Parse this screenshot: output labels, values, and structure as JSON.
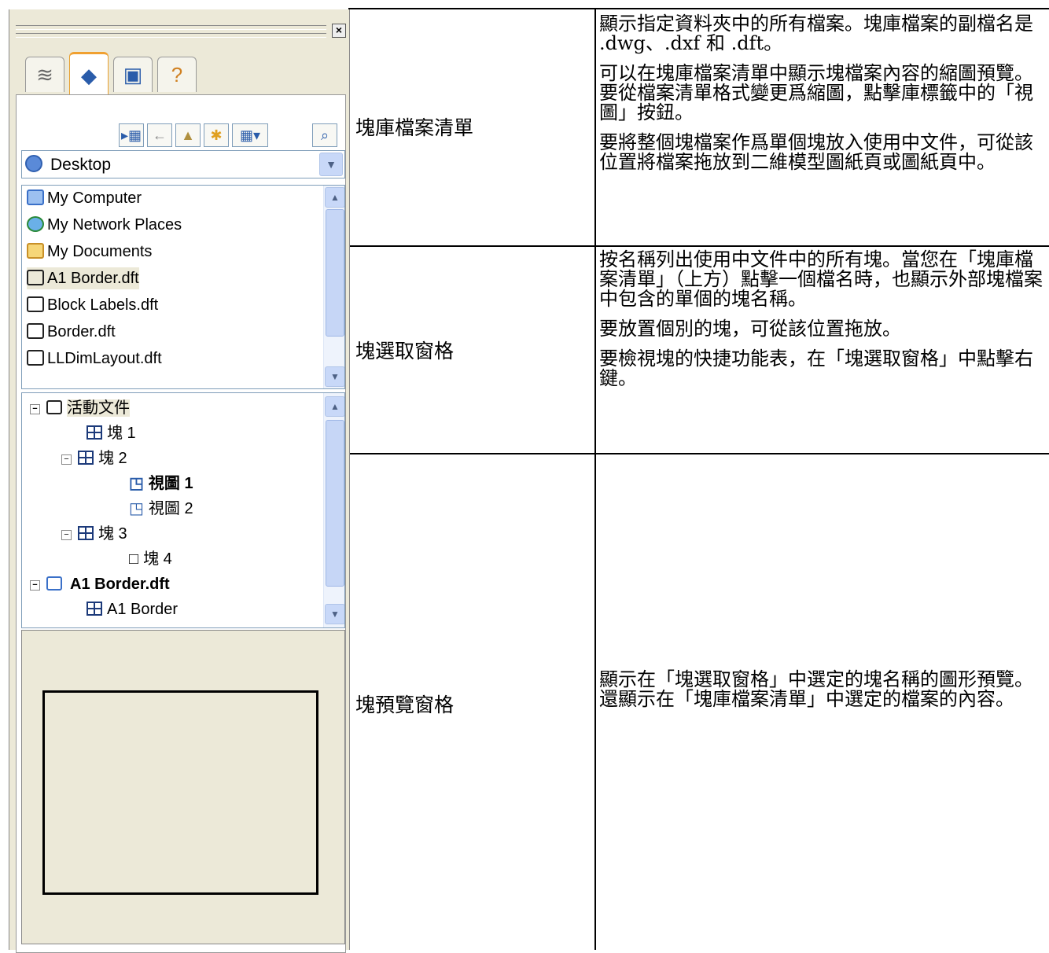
{
  "panel": {
    "combo_value": "Desktop",
    "file_list": [
      "My Computer",
      "My Network Places",
      "My Documents",
      "A1 Border.dft",
      "Block Labels.dft",
      "Border.dft",
      "LLDimLayout.dft"
    ],
    "tree": [
      {
        "label": "活動文件",
        "level": 0
      },
      {
        "label": "塊 1",
        "level": 1
      },
      {
        "label": "塊 2",
        "level": 1
      },
      {
        "label": "視圖 1",
        "level": 2
      },
      {
        "label": "視圖 2",
        "level": 2
      },
      {
        "label": "塊 3",
        "level": 1
      },
      {
        "label": "塊 4",
        "level": 2
      },
      {
        "label": "A1 Border.dft",
        "level": 0
      },
      {
        "label": "A1 Border",
        "level": 1
      }
    ]
  },
  "table": {
    "rows": [
      {
        "label": "塊庫檔案清單",
        "paragraphs": [
          "顯示指定資料夾中的所有檔案。塊庫檔案的副檔名是 .dwg、.dxf 和 .dft。",
          "可以在塊庫檔案清單中顯示塊檔案內容的縮圖預覽。要從檔案清單格式變更爲縮圖，點擊庫標籤中的「視圖」按鈕。",
          "要將整個塊檔案作爲單個塊放入使用中文件，可從該位置將檔案拖放到二維模型圖紙頁或圖紙頁中。"
        ]
      },
      {
        "label": "塊選取窗格",
        "paragraphs": [
          "按名稱列出使用中文件中的所有塊。當您在「塊庫檔案清單」（上方）點擊一個檔名時，也顯示外部塊檔案中包含的單個的塊名稱。",
          "要放置個別的塊，可從該位置拖放。",
          "要檢視塊的快捷功能表，在「塊選取窗格」中點擊右鍵。"
        ]
      },
      {
        "label": "塊預覽窗格",
        "paragraphs": [
          "顯示在「塊選取窗格」中選定的塊名稱的圖形預覽。還顯示在「塊庫檔案清單」中選定的檔案的內容。"
        ]
      }
    ]
  }
}
